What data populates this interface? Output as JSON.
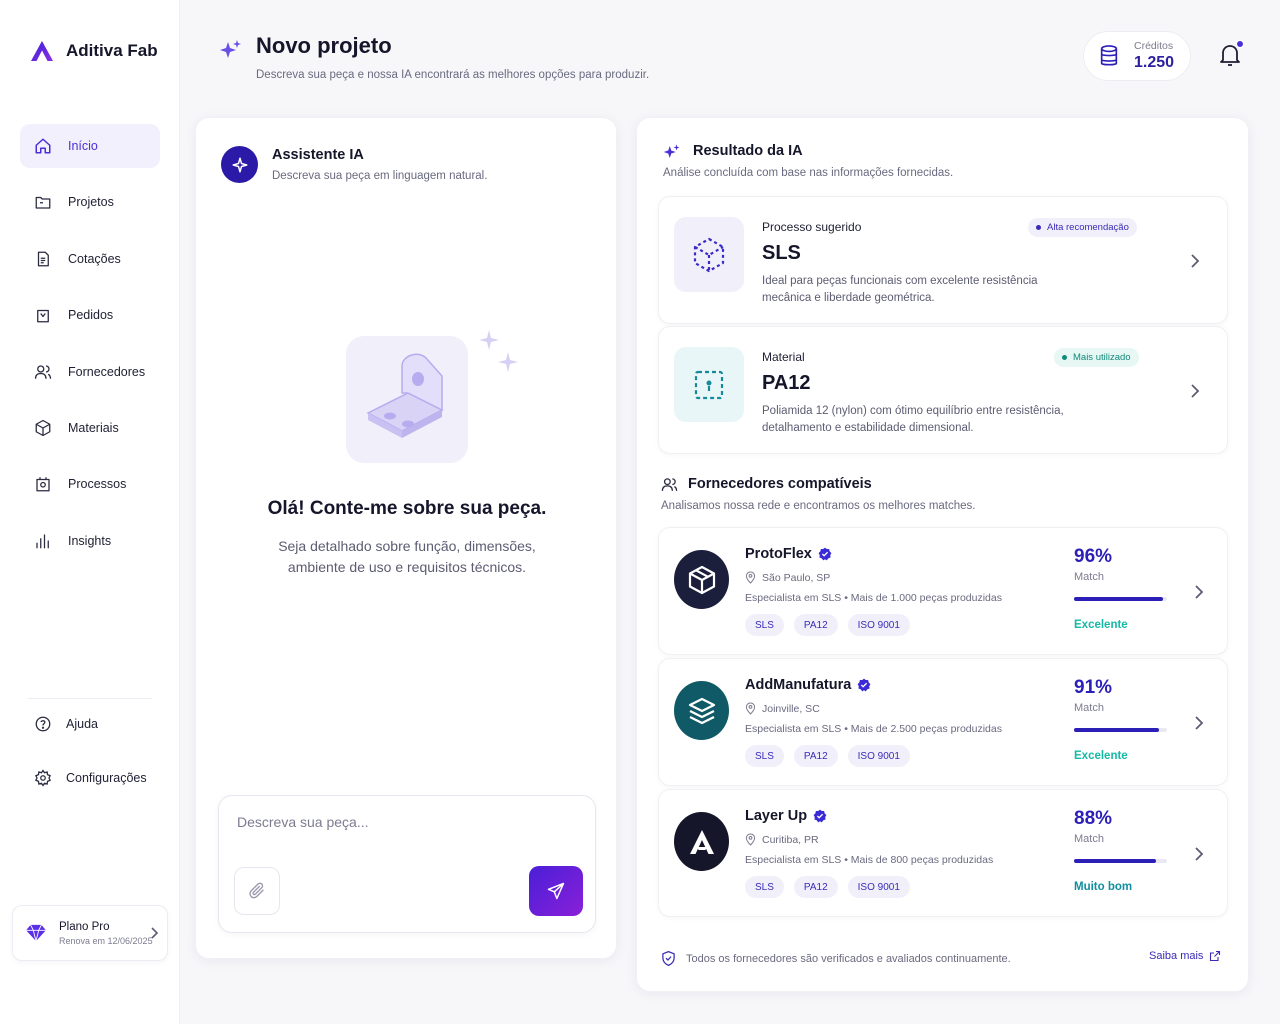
{
  "app": {
    "name": "Aditiva Fab"
  },
  "sidebar": {
    "items": [
      {
        "label": "Início",
        "icon": "home-icon",
        "active": true
      },
      {
        "label": "Projetos",
        "icon": "folder-icon",
        "active": false
      },
      {
        "label": "Cotações",
        "icon": "document-icon",
        "active": false
      },
      {
        "label": "Pedidos",
        "icon": "bag-icon",
        "active": false
      },
      {
        "label": "Fornecedores",
        "icon": "users-icon",
        "active": false
      },
      {
        "label": "Materiais",
        "icon": "cube-icon",
        "active": false
      },
      {
        "label": "Processos",
        "icon": "process-icon",
        "active": false
      },
      {
        "label": "Insights",
        "icon": "chart-icon",
        "active": false
      }
    ],
    "help": {
      "label": "Ajuda",
      "icon": "help-icon"
    },
    "settings": {
      "label": "Configurações",
      "icon": "gear-icon"
    },
    "plan": {
      "title": "Plano Pro",
      "renewal": "Renova em 12/06/2025",
      "icon": "diamond-icon"
    }
  },
  "header": {
    "title": "Novo projeto",
    "subtitle": "Descreva sua peça e nossa IA encontrará as melhores opções para produzir.",
    "credits_label": "Créditos",
    "credits_value": "1.250"
  },
  "assistant": {
    "title": "Assistente IA",
    "subtitle": "Descreva sua peça em linguagem natural.",
    "greeting": "Olá! Conte-me sobre sua peça.",
    "hint": "Seja detalhado sobre função, dimensões, ambiente de uso e requisitos técnicos.",
    "input_placeholder": "Descreva sua peça..."
  },
  "results": {
    "title": "Resultado da IA",
    "subtitle": "Análise concluída com base nas informações fornecidas.",
    "recommendations": [
      {
        "label": "Processo sugerido",
        "value": "SLS",
        "badge": "Alta recomendação",
        "description": "Ideal para peças funcionais com excelente resistência mecânica e liberdade geométrica.",
        "icon": "cube-dotted-icon"
      },
      {
        "label": "Material",
        "value": "PA12",
        "badge": "Mais utilizado",
        "description": "Poliamida 12 (nylon) com ótimo equilíbrio entre resistência, detalhamento e estabilidade dimensional.",
        "icon": "material-frame-icon"
      }
    ],
    "suppliers_title": "Fornecedores compatíveis",
    "suppliers_subtitle": "Analisamos nossa rede e encontramos os melhores matches.",
    "suppliers": [
      {
        "name": "ProtoFlex",
        "location": "São Paulo, SP",
        "description": "Especialista em SLS • Mais de 1.000 peças produzidas",
        "tags": [
          "SLS",
          "PA12",
          "ISO 9001"
        ],
        "match_pct": "96%",
        "match_label": "Match",
        "match_value": 0.96,
        "quality": "Excelente",
        "logo_color": "#1c1f3b"
      },
      {
        "name": "AddManufatura",
        "location": "Joinville, SC",
        "description": "Especialista em SLS • Mais de 2.500 peças produzidas",
        "tags": [
          "SLS",
          "PA12",
          "ISO 9001"
        ],
        "match_pct": "91%",
        "match_label": "Match",
        "match_value": 0.91,
        "quality": "Excelente",
        "logo_color": "#0f5a66"
      },
      {
        "name": "Layer Up",
        "location": "Curitiba, PR",
        "description": "Especialista em SLS • Mais de 800 peças produzidas",
        "tags": [
          "SLS",
          "PA12",
          "ISO 9001"
        ],
        "match_pct": "88%",
        "match_label": "Match",
        "match_value": 0.88,
        "quality": "Muito bom",
        "logo_color": "#16162b"
      }
    ],
    "footer_note": "Todos os fornecedores são verificados e avaliados continuamente.",
    "footer_link": "Saiba mais"
  },
  "colors": {
    "accent": "#4a2fd6",
    "quality_excellent": "#16b8a6",
    "quality_verygood": "#0f8f9f"
  }
}
